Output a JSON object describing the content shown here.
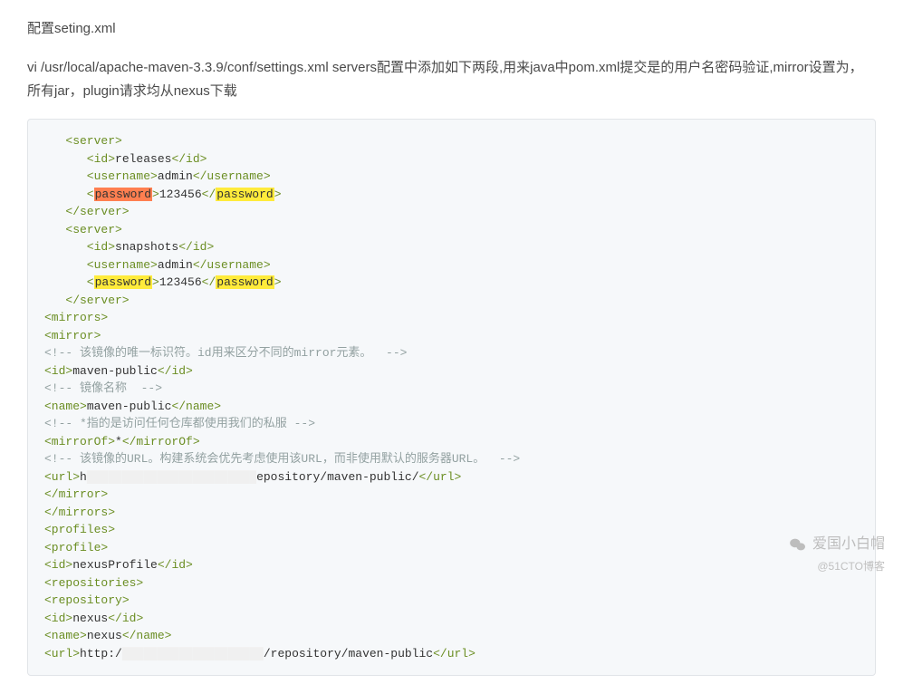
{
  "heading": "配置seting.xml",
  "paragraph": "vi /usr/local/apache-maven-3.3.9/conf/settings.xml servers配置中添加如下两段,用来java中pom.xml提交是的用户名密码验证,mirror设置为，所有jar，plugin请求均从nexus下载",
  "code": {
    "l1": "<server>",
    "l2_open": "<id>",
    "l2_text": "releases",
    "l2_close": "</id>",
    "l3_open": "<username>",
    "l3_text": "admin",
    "l3_close": "</username>",
    "l4_open_b": "<",
    "l4_open_pw": "password",
    "l4_open_e": ">",
    "l4_text": "123456",
    "l4_close_b": "</",
    "l4_close_pw": "password",
    "l4_close_e": ">",
    "l5": "</server>",
    "l6": "<server>",
    "l7_open": "<id>",
    "l7_text": "snapshots",
    "l7_close": "</id>",
    "l8_open": "<username>",
    "l8_text": "admin",
    "l8_close": "</username>",
    "l9_open_b": "<",
    "l9_open_pw": "password",
    "l9_open_e": ">",
    "l9_text": "123456",
    "l9_close_b": "</",
    "l9_close_pw": "password",
    "l9_close_e": ">",
    "l10": "</server>",
    "l11": "<mirrors>",
    "l12": "<mirror>",
    "l13": "<!-- 该镜像的唯一标识符。id用来区分不同的mirror元素。  -->",
    "l14_open": "<id>",
    "l14_text": "maven-public",
    "l14_close": "</id>",
    "l15": "<!-- 镜像名称  -->",
    "l16_open": "<name>",
    "l16_text": "maven-public",
    "l16_close": "</name>",
    "l17": "<!-- *指的是访问任何仓库都使用我们的私服 -->",
    "l18_open": "<mirrorOf>",
    "l18_text": "*",
    "l18_close": "</mirrorOf>",
    "l19": "<!-- 该镜像的URL。构建系统会优先考虑使用该URL，而非使用默认的服务器URL。  -->",
    "l20_open": "<url>",
    "l20_text_a": "h",
    "l20_text_b": "epository/maven-public/",
    "l20_close": "</url>",
    "l21": "</mirror>",
    "l22": "</mirrors>",
    "l23": "<profiles>",
    "l24": "<profile>",
    "l25_open": "<id>",
    "l25_text": "nexusProfile",
    "l25_close": "</id>",
    "l26": "<repositories>",
    "l27": "<repository>",
    "l28_open": "<id>",
    "l28_text": "nexus",
    "l28_close": "</id>",
    "l29_open": "<name>",
    "l29_text": "nexus",
    "l29_close": "</name>",
    "l30_open": "<url>",
    "l30_text_a": "http:/",
    "l30_text_b": "/repository/maven-public",
    "l30_close": "</url>"
  },
  "watermark": {
    "text": "爱国小白帽",
    "sub": "@51CTO博客"
  }
}
